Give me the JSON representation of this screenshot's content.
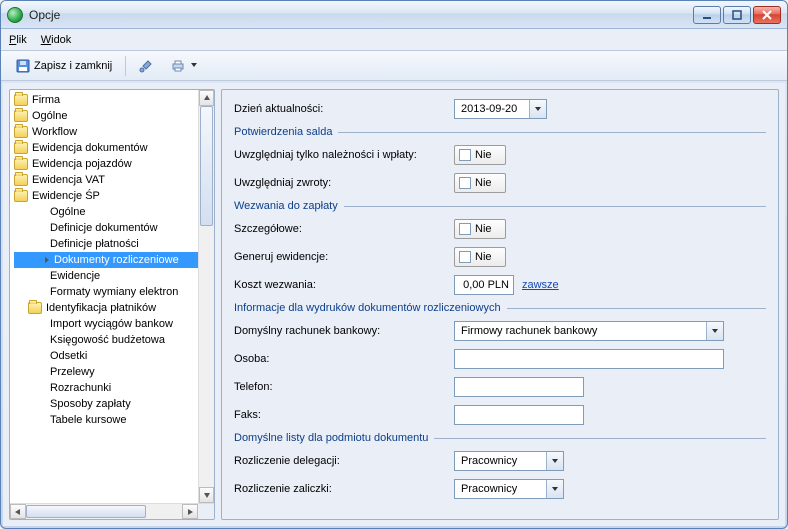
{
  "window": {
    "title": "Opcje"
  },
  "menu": {
    "file": "Plik",
    "view": "Widok"
  },
  "toolbar": {
    "save_close": "Zapisz i zamknij"
  },
  "tree": {
    "firma": "Firma",
    "ogolne": "Ogólne",
    "workflow": "Workflow",
    "ewid_dok": "Ewidencja dokumentów",
    "ewid_poj": "Ewidencja pojazdów",
    "ewid_vat": "Ewidencja VAT",
    "ewid_sp": "Ewidencje ŚP",
    "sp_ogolne": "Ogólne",
    "sp_def_dok": "Definicje dokumentów",
    "sp_def_plat": "Definicje płatności",
    "sp_dok_rozl": "Dokumenty rozliczeniowe",
    "sp_ewidencje": "Ewidencje",
    "sp_formaty": "Formaty wymiany elektron",
    "sp_identyfikacja": "Identyfikacja płatników",
    "sp_import": "Import wyciągów bankow",
    "sp_ksiegowosc": "Księgowość budżetowa",
    "sp_odsetki": "Odsetki",
    "sp_przelewy": "Przelewy",
    "sp_rozrachunki": "Rozrachunki",
    "sp_sposoby": "Sposoby zapłaty",
    "sp_tabele": "Tabele kursowe"
  },
  "form": {
    "date_label": "Dzień aktualności:",
    "date_value": "2013-09-20",
    "grp_potw": "Potwierdzenia salda",
    "uwz_nalez": "Uwzględniaj tylko należności i wpłaty:",
    "uwz_zwroty": "Uwzględniaj zwroty:",
    "grp_wezw": "Wezwania do zapłaty",
    "szczegolowe": "Szczegółowe:",
    "gen_ewid": "Generuj ewidencje:",
    "koszt_wezw": "Koszt wezwania:",
    "koszt_val": "0,00 PLN",
    "zawsze": "zawsze",
    "grp_info": "Informacje dla wydruków dokumentów rozliczeniowych",
    "dom_rach": "Domyślny rachunek bankowy:",
    "dom_rach_val": "Firmowy rachunek bankowy",
    "osoba": "Osoba:",
    "telefon": "Telefon:",
    "faks": "Faks:",
    "grp_listy": "Domyślne listy dla podmiotu dokumentu",
    "rozl_deleg": "Rozliczenie delegacji:",
    "rozl_zal": "Rozliczenie zaliczki:",
    "pracownicy": "Pracownicy",
    "no": "Nie"
  }
}
